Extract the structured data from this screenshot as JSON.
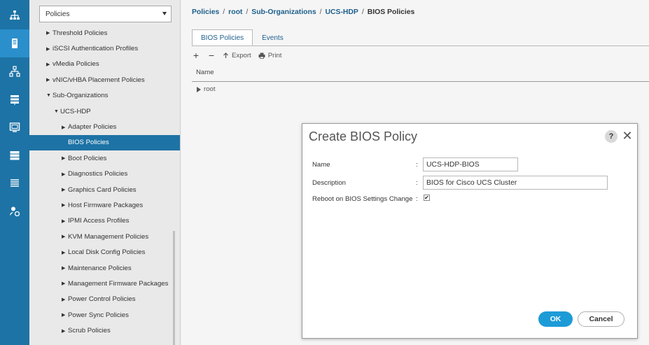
{
  "rail": {
    "icons": [
      "network-topology-icon",
      "server-icon",
      "network-icon",
      "storage-icon",
      "vm-icon",
      "chassis-icon",
      "list-icon",
      "admin-icon"
    ],
    "active_index": 1
  },
  "nav": {
    "select_value": "Policies",
    "items": [
      {
        "label": "Threshold Policies",
        "level": 1,
        "expanded": false
      },
      {
        "label": "iSCSI Authentication Profiles",
        "level": 1,
        "expanded": false
      },
      {
        "label": "vMedia Policies",
        "level": 1,
        "expanded": false
      },
      {
        "label": "vNIC/vHBA Placement Policies",
        "level": 1,
        "expanded": false
      },
      {
        "label": "Sub-Organizations",
        "level": 1,
        "expanded": true
      },
      {
        "label": "UCS-HDP",
        "level": 2,
        "expanded": true
      },
      {
        "label": "Adapter Policies",
        "level": 3,
        "expanded": false
      },
      {
        "label": "BIOS Policies",
        "level": 3,
        "selected": true
      },
      {
        "label": "Boot Policies",
        "level": 3,
        "expanded": false
      },
      {
        "label": "Diagnostics Policies",
        "level": 3,
        "expanded": false
      },
      {
        "label": "Graphics Card Policies",
        "level": 3,
        "expanded": false
      },
      {
        "label": "Host Firmware Packages",
        "level": 3,
        "expanded": false
      },
      {
        "label": "IPMI Access Profiles",
        "level": 3,
        "expanded": false
      },
      {
        "label": "KVM Management Policies",
        "level": 3,
        "expanded": false
      },
      {
        "label": "Local Disk Config Policies",
        "level": 3,
        "expanded": false
      },
      {
        "label": "Maintenance Policies",
        "level": 3,
        "expanded": false
      },
      {
        "label": "Management Firmware Packages",
        "level": 3,
        "expanded": false
      },
      {
        "label": "Power Control Policies",
        "level": 3,
        "expanded": false
      },
      {
        "label": "Power Sync Policies",
        "level": 3,
        "expanded": false
      },
      {
        "label": "Scrub Policies",
        "level": 3,
        "expanded": false
      }
    ]
  },
  "main": {
    "breadcrumb": [
      "Policies",
      "root",
      "Sub-Organizations",
      "UCS-HDP",
      "BIOS Policies"
    ],
    "tabs": [
      "BIOS Policies",
      "Events"
    ],
    "active_tab": 0,
    "toolbar": {
      "add": "+",
      "remove": "−",
      "export": "Export",
      "print": "Print"
    },
    "column_name": "Name",
    "row_root": "root"
  },
  "dialog": {
    "title": "Create BIOS Policy",
    "help": "?",
    "close": "✕",
    "fields": {
      "name_label": "Name",
      "name_value": "UCS-HDP-BIOS",
      "description_label": "Description",
      "description_value": "BIOS for Cisco UCS Cluster",
      "reboot_label": "Reboot on BIOS Settings Change",
      "reboot_checked": true,
      "colon": ":"
    },
    "ok_label": "OK",
    "cancel_label": "Cancel"
  },
  "colors": {
    "rail_bg": "#1d73a5",
    "rail_active": "#2a8fcb",
    "selected_bg": "#1d73a5",
    "ok_button": "#1d9bd7",
    "link": "#1d5f8c"
  }
}
